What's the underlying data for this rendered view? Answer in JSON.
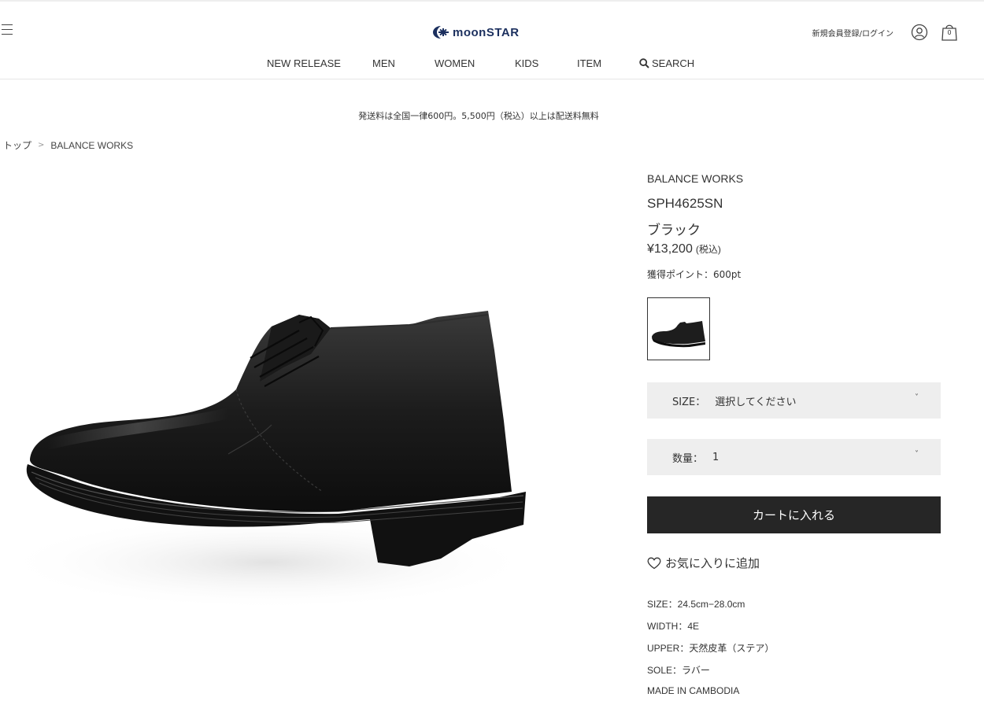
{
  "header": {
    "logo_text": "moonSTAR",
    "login_label": "新規会員登録/ログイン",
    "cart_count": "0",
    "icons": [
      "hamburger-menu-icon",
      "moonstar-logo-icon",
      "user-icon",
      "shopping-bag-icon",
      "search-icon"
    ]
  },
  "nav": {
    "items": [
      "NEW RELEASE",
      "MEN",
      "WOMEN",
      "KIDS",
      "ITEM"
    ],
    "search_label": "SEARCH"
  },
  "notice": "発送料は全国一律600円。5,500円（税込）以上は配送料無料",
  "breadcrumb": {
    "home": "トップ",
    "separator": ">",
    "current": "BALANCE WORKS"
  },
  "product": {
    "brand": "BALANCE WORKS",
    "model": "SPH4625SN",
    "color": "ブラック",
    "price": "¥13,200",
    "tax_note": "(税込)",
    "points": "獲得ポイント：600pt"
  },
  "size_select": {
    "label": "SIZE：",
    "value": "選択してください"
  },
  "qty_select": {
    "label": "数量：",
    "value": "1"
  },
  "add_to_cart": "カートに入れる",
  "favorite": "お気に入りに追加",
  "specs": [
    "SIZE：24.5cm−28.0cm",
    "WIDTH：4E",
    "UPPER：天然皮革（ステア）",
    "SOLE：ラバー",
    "MADE IN CAMBODIA"
  ],
  "colors": {
    "logo": "#1b2f5e",
    "select_bg": "#eeeeee",
    "cart_button": "#262626"
  }
}
